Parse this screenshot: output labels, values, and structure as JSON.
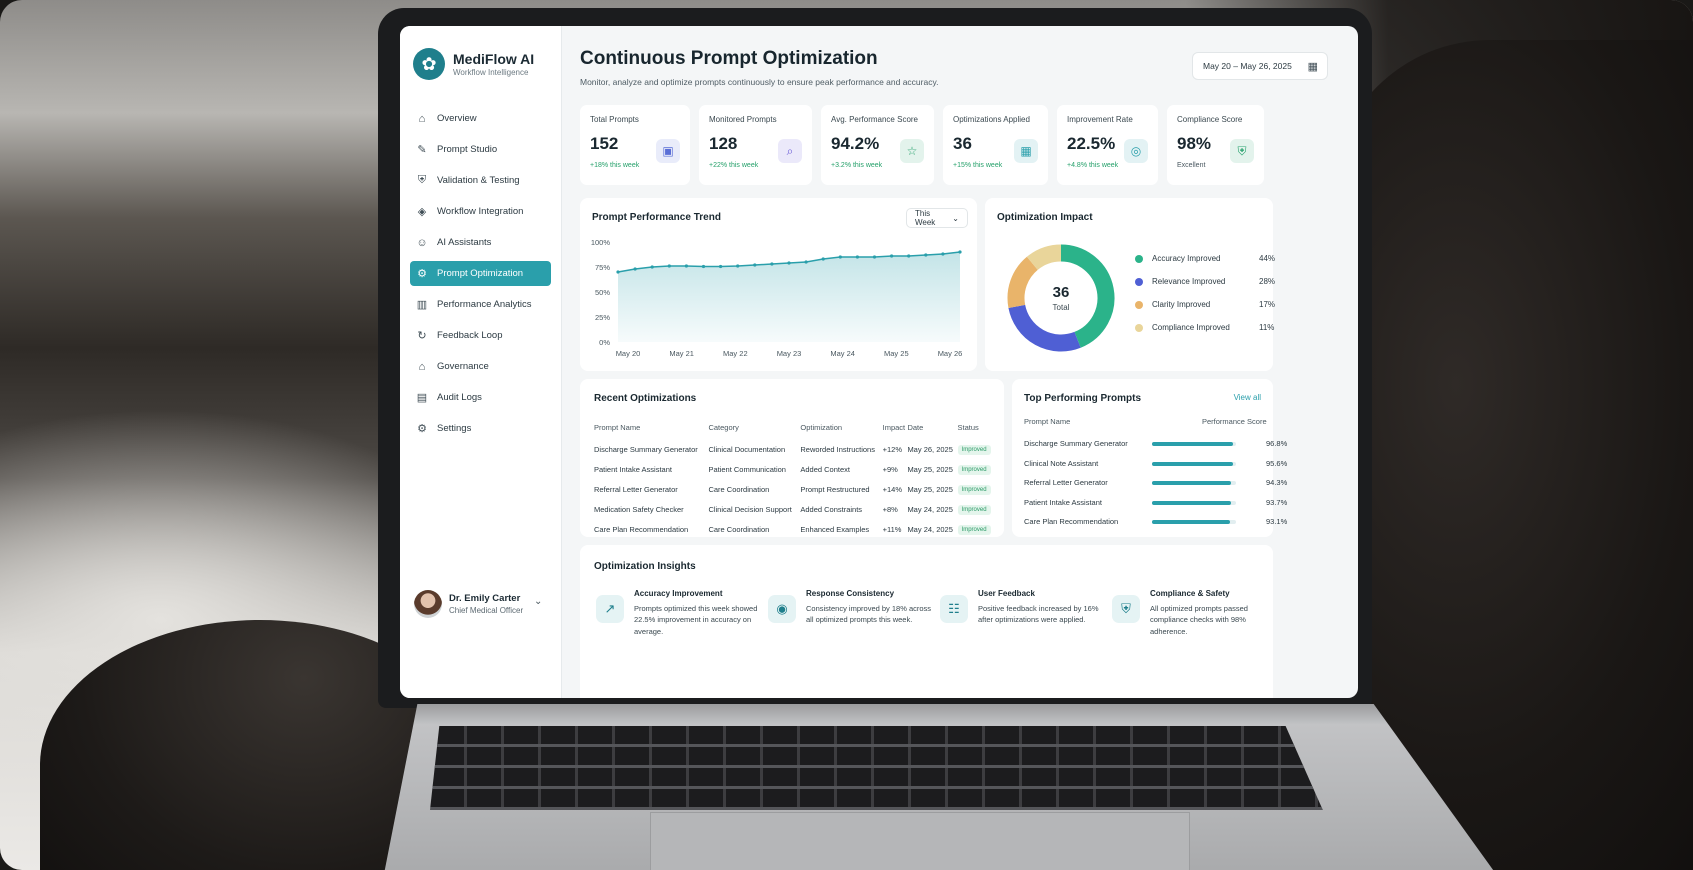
{
  "app": {
    "name": "MediFlow AI",
    "tagline": "Workflow Intelligence"
  },
  "sidebar": {
    "items": [
      {
        "label": "Overview",
        "icon": "home-icon"
      },
      {
        "label": "Prompt Studio",
        "icon": "prompt-studio-icon"
      },
      {
        "label": "Validation & Testing",
        "icon": "shield-check-icon"
      },
      {
        "label": "Workflow Integration",
        "icon": "cube-icon"
      },
      {
        "label": "AI Assistants",
        "icon": "robot-icon"
      },
      {
        "label": "Prompt Optimization",
        "icon": "optimization-icon",
        "active": true
      },
      {
        "label": "Performance Analytics",
        "icon": "bar-chart-icon"
      },
      {
        "label": "Feedback Loop",
        "icon": "loop-icon"
      },
      {
        "label": "Governance",
        "icon": "building-icon"
      },
      {
        "label": "Audit Logs",
        "icon": "document-icon"
      },
      {
        "label": "Settings",
        "icon": "gear-icon"
      }
    ],
    "user": {
      "name": "Dr. Emily Carter",
      "role": "Chief Medical Officer"
    }
  },
  "header": {
    "title": "Continuous Prompt Optimization",
    "subtitle": "Monitor, analyze and optimize prompts continuously to ensure peak performance and accuracy.",
    "date_range": "May 20 – May 26, 2025"
  },
  "kpis": [
    {
      "label": "Total Prompts",
      "value": "152",
      "delta": "+18% this week",
      "icon": "prompt-icon",
      "color": "#5b6fd6"
    },
    {
      "label": "Monitored Prompts",
      "value": "128",
      "delta": "+22% this week",
      "icon": "monitor-search-icon",
      "color": "#6a5bd6"
    },
    {
      "label": "Avg. Performance Score",
      "value": "94.2%",
      "delta": "+3.2% this week",
      "icon": "star-icon",
      "color": "#2aa36f"
    },
    {
      "label": "Optimizations Applied",
      "value": "36",
      "delta": "+15% this week",
      "icon": "optimization-list-icon",
      "color": "#2a9fab"
    },
    {
      "label": "Improvement Rate",
      "value": "22.5%",
      "delta": "+4.8% this week",
      "icon": "target-icon",
      "color": "#2a9fab"
    },
    {
      "label": "Compliance Score",
      "value": "98%",
      "delta": "Excellent",
      "icon": "shield-check-icon",
      "color": "#2aa36f"
    }
  ],
  "trend": {
    "title": "Prompt Performance Trend",
    "period": "This Week",
    "color": "#2a9fab"
  },
  "chart_data": [
    {
      "type": "area",
      "title": "Prompt Performance Trend",
      "x": [
        "May 20",
        "May 21",
        "May 22",
        "May 23",
        "May 24",
        "May 25",
        "May 26"
      ],
      "y_ticks": [
        "0%",
        "25%",
        "50%",
        "75%",
        "100%"
      ],
      "ylim": [
        0,
        100
      ],
      "series": [
        {
          "values": [
            70,
            73,
            75,
            76,
            76,
            75.5,
            75.5,
            76,
            77,
            78,
            79,
            80,
            83,
            85,
            85,
            85,
            86,
            86,
            87,
            88,
            90
          ]
        }
      ],
      "grid": false
    },
    {
      "type": "pie",
      "title": "Optimization Impact",
      "center_value": "36",
      "center_label": "Total",
      "slices": [
        {
          "name": "Accuracy Improved",
          "value": 44,
          "label": "44%",
          "color": "#2bb38a"
        },
        {
          "name": "Relevance Improved",
          "value": 28,
          "label": "28%",
          "color": "#4f5fd4"
        },
        {
          "name": "Clarity Improved",
          "value": 17,
          "label": "17%",
          "color": "#e9b46a"
        },
        {
          "name": "Compliance Improved",
          "value": 11,
          "label": "11%",
          "color": "#e9d59a"
        }
      ]
    }
  ],
  "recent": {
    "title": "Recent Optimizations",
    "columns": [
      "Prompt Name",
      "Category",
      "Optimization",
      "Impact",
      "Date",
      "Status"
    ],
    "rows": [
      [
        "Discharge Summary Generator",
        "Clinical Documentation",
        "Reworded Instructions",
        "+12%",
        "May 26, 2025",
        "Improved"
      ],
      [
        "Patient Intake Assistant",
        "Patient Communication",
        "Added Context",
        "+9%",
        "May 25, 2025",
        "Improved"
      ],
      [
        "Referral Letter Generator",
        "Care Coordination",
        "Prompt Restructured",
        "+14%",
        "May 25, 2025",
        "Improved"
      ],
      [
        "Medication Safety Checker",
        "Clinical Decision Support",
        "Added Constraints",
        "+8%",
        "May 24, 2025",
        "Improved"
      ],
      [
        "Care Plan Recommendation",
        "Care Coordination",
        "Enhanced Examples",
        "+11%",
        "May 24, 2025",
        "Improved"
      ]
    ]
  },
  "top": {
    "title": "Top Performing Prompts",
    "view_all": "View all",
    "col_name": "Prompt Name",
    "col_score": "Performance Score",
    "rows": [
      {
        "name": "Discharge Summary Generator",
        "score": "96.8%",
        "fraction": 0.968
      },
      {
        "name": "Clinical Note Assistant",
        "score": "95.6%",
        "fraction": 0.956
      },
      {
        "name": "Referral Letter Generator",
        "score": "94.3%",
        "fraction": 0.943
      },
      {
        "name": "Patient Intake Assistant",
        "score": "93.7%",
        "fraction": 0.937
      },
      {
        "name": "Care Plan Recommendation",
        "score": "93.1%",
        "fraction": 0.931
      }
    ]
  },
  "insights": {
    "title": "Optimization Insights",
    "items": [
      {
        "title": "Accuracy Improvement",
        "body": "Prompts optimized this week showed 22.5% improvement in accuracy on average.",
        "icon": "trend-up-icon"
      },
      {
        "title": "Response Consistency",
        "body": "Consistency improved by 18% across all optimized prompts this week.",
        "icon": "consistency-icon"
      },
      {
        "title": "User Feedback",
        "body": "Positive feedback increased by 16% after optimizations were applied.",
        "icon": "feedback-icon"
      },
      {
        "title": "Compliance & Safety",
        "body": "All optimized prompts passed compliance checks with 98% adherence.",
        "icon": "shield-check-icon"
      }
    ]
  }
}
